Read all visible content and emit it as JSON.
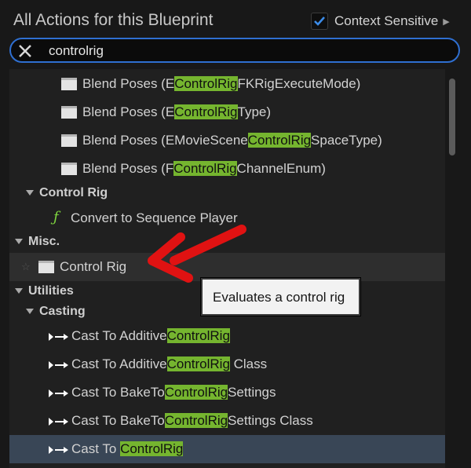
{
  "header": {
    "title": "All Actions for this Blueprint",
    "context_sensitive_label": "Context Sensitive",
    "context_sensitive_checked": true
  },
  "search": {
    "value": "controlrig"
  },
  "rows": {
    "r0": {
      "pre": "Blend Poses (E",
      "hl": "ControlRig",
      "post": "FKRigExecuteMode)"
    },
    "r1": {
      "pre": "Blend Poses (E",
      "hl": "ControlRig",
      "post": "Type)"
    },
    "r2": {
      "pre": "Blend Poses (EMovieScene",
      "hl": "ControlRig",
      "post": "SpaceType)"
    },
    "r3": {
      "pre": "Blend Poses (F",
      "hl": "ControlRig",
      "post": "ChannelEnum)"
    },
    "c1": {
      "label": "Control Rig"
    },
    "r4": {
      "label": "Convert to Sequence Player"
    },
    "c2": {
      "label": "Misc."
    },
    "r5": {
      "label": "Control Rig"
    },
    "c3": {
      "label": "Utilities"
    },
    "c4": {
      "label": "Casting"
    },
    "r6": {
      "pre": "Cast To Additive",
      "hl": "ControlRig",
      "post": ""
    },
    "r7": {
      "pre": "Cast To Additive",
      "hl": "ControlRig",
      "post": " Class"
    },
    "r8": {
      "pre": "Cast To BakeTo",
      "hl": "ControlRig",
      "post": "Settings"
    },
    "r9": {
      "pre": "Cast To BakeTo",
      "hl": "ControlRig",
      "post": "Settings Class"
    },
    "r10": {
      "pre": "Cast To ",
      "hl": "ControlRig",
      "post": ""
    }
  },
  "tooltip": {
    "text": "Evaluates a control rig"
  },
  "colors": {
    "accent": "#2f6fd1",
    "highlight": "#75b52f",
    "selected_row": "#394656",
    "annotation_arrow": "#e01212"
  }
}
